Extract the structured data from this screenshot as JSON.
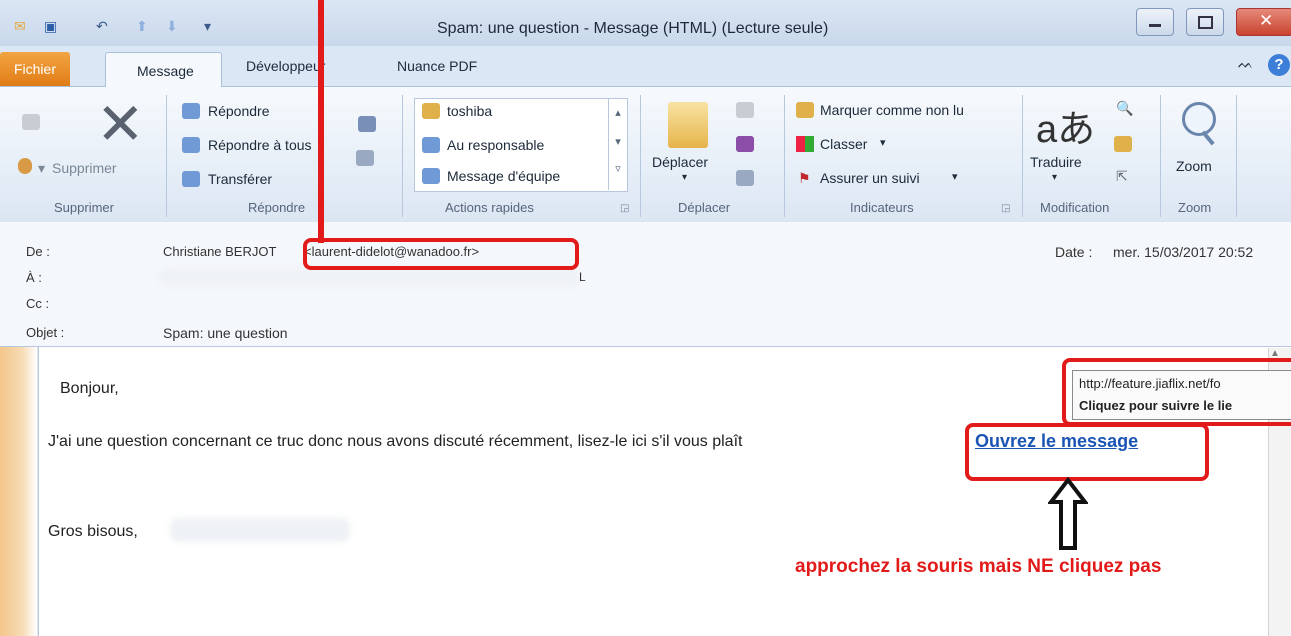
{
  "window": {
    "title": "Spam: une question  -  Message (HTML) (Lecture seule)"
  },
  "tabs": [
    "Fichier",
    "Message",
    "Développeur",
    "Nuance PDF"
  ],
  "ribbon": {
    "supprimer": {
      "button": "Supprimer",
      "label": "Supprimer"
    },
    "repondre": {
      "items": [
        "Répondre",
        "Répondre à tous",
        "Transférer"
      ],
      "label": "Répondre"
    },
    "actions_rapides": {
      "items": [
        "toshiba",
        "Au responsable",
        "Message d'équipe"
      ],
      "label": "Actions rapides"
    },
    "deplacer": {
      "button": "Déplacer",
      "label": "Déplacer"
    },
    "indicateurs": {
      "items": [
        "Marquer comme non lu",
        "Classer",
        "Assurer un suivi"
      ],
      "label": "Indicateurs"
    },
    "modification": {
      "button": "Traduire",
      "label": "Modification"
    },
    "zoom": {
      "button": "Zoom",
      "label": "Zoom"
    }
  },
  "header": {
    "de_label": "De :",
    "de_name": "Christiane BERJOT",
    "de_email": "<laurent-didelot@wanadoo.fr>",
    "a_label": "À :",
    "cc_label": "Cc :",
    "objet_label": "Objet :",
    "objet_value": "Spam: une question",
    "date_label": "Date :",
    "date_value": "mer. 15/03/2017 20:52"
  },
  "message": {
    "greeting": "Bonjour,",
    "line": "J'ai une question concernant ce truc donc nous avons discuté récemment, lisez-le ici s'il vous plaît",
    "link": "Ouvrez le message",
    "closing": "Gros bisous,"
  },
  "tooltip": {
    "url": "http://feature.jiaflix.net/fo",
    "hint": "Cliquez pour suivre le lie"
  },
  "annotation": {
    "text": "approchez la souris mais NE cliquez pas"
  },
  "colors": {
    "annotation_red": "#e21a1a",
    "link_blue": "#1a55b5",
    "file_tab_orange": "#e88a20"
  }
}
